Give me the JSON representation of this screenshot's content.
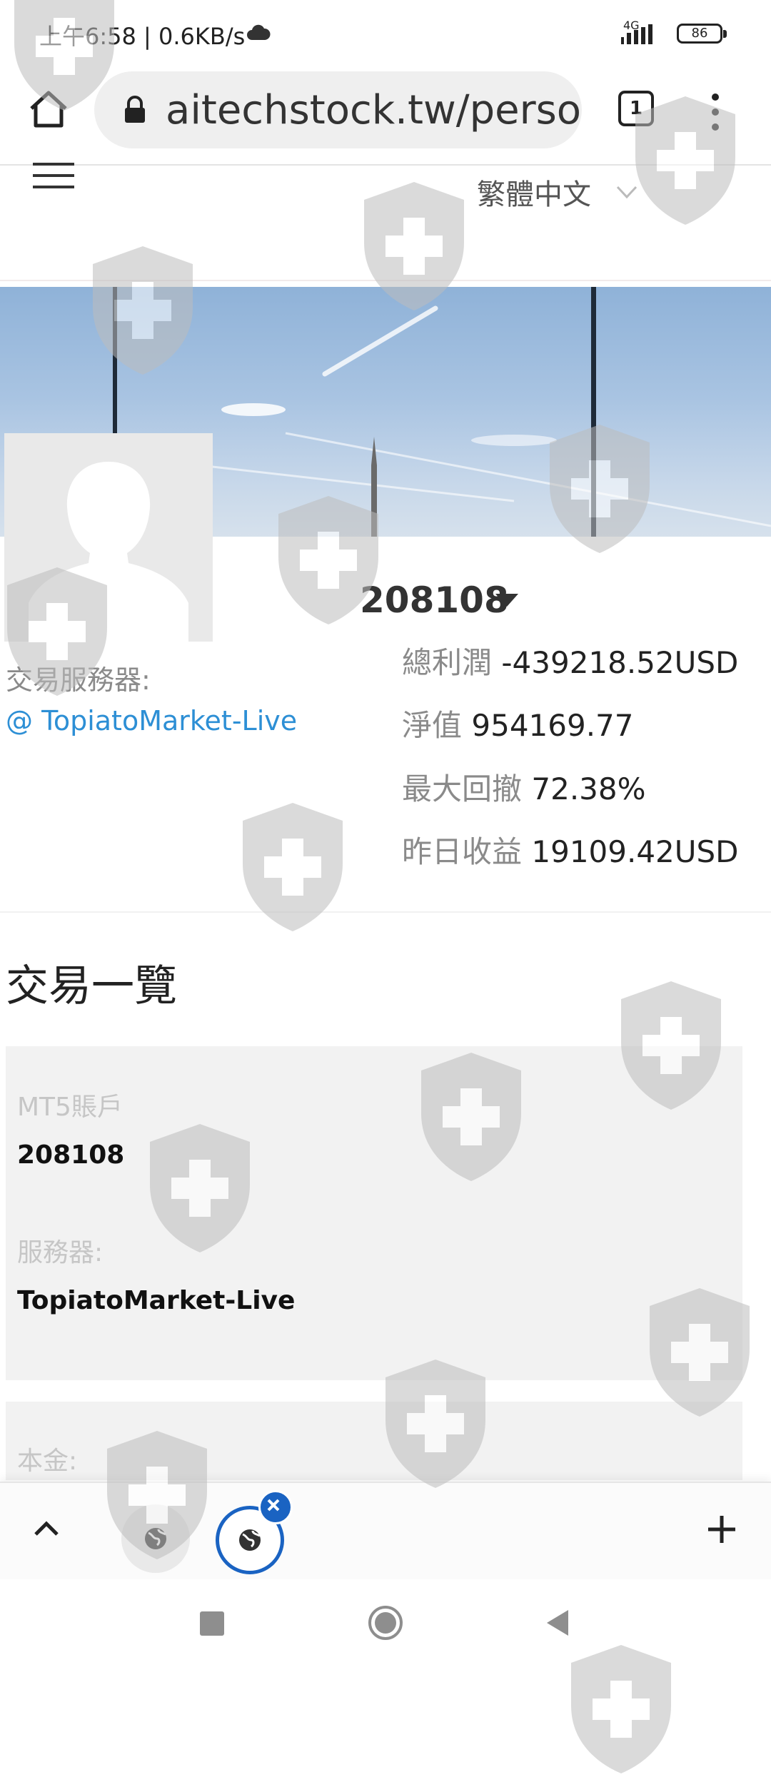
{
  "status_bar": {
    "time_speed": "上午6:58 | 0.6KB/s",
    "network": "4G",
    "battery": "86"
  },
  "browser": {
    "url": "aitechstock.tw/personal",
    "tab_count": "1"
  },
  "site_header": {
    "language": "繁體中文"
  },
  "profile": {
    "account_id": "208108",
    "server_label": "交易服務器:",
    "server_link": "@ TopiatoMarket-Live"
  },
  "stats": [
    {
      "label": "總利潤",
      "value": "-439218.52USD"
    },
    {
      "label": "淨值",
      "value": "954169.77"
    },
    {
      "label": "最大回撤",
      "value": "72.38%"
    },
    {
      "label": "昨日收益",
      "value": "19109.42USD"
    }
  ],
  "section": {
    "title": "交易一覽"
  },
  "card": {
    "account_label": "MT5賬戶",
    "account_value": "208108",
    "server_label": "服務器:",
    "server_value": "TopiatoMarket-Live",
    "principal_label": "本金:"
  },
  "colors": {
    "link": "#2d8fd5",
    "active_tab": "#1a63c2"
  }
}
